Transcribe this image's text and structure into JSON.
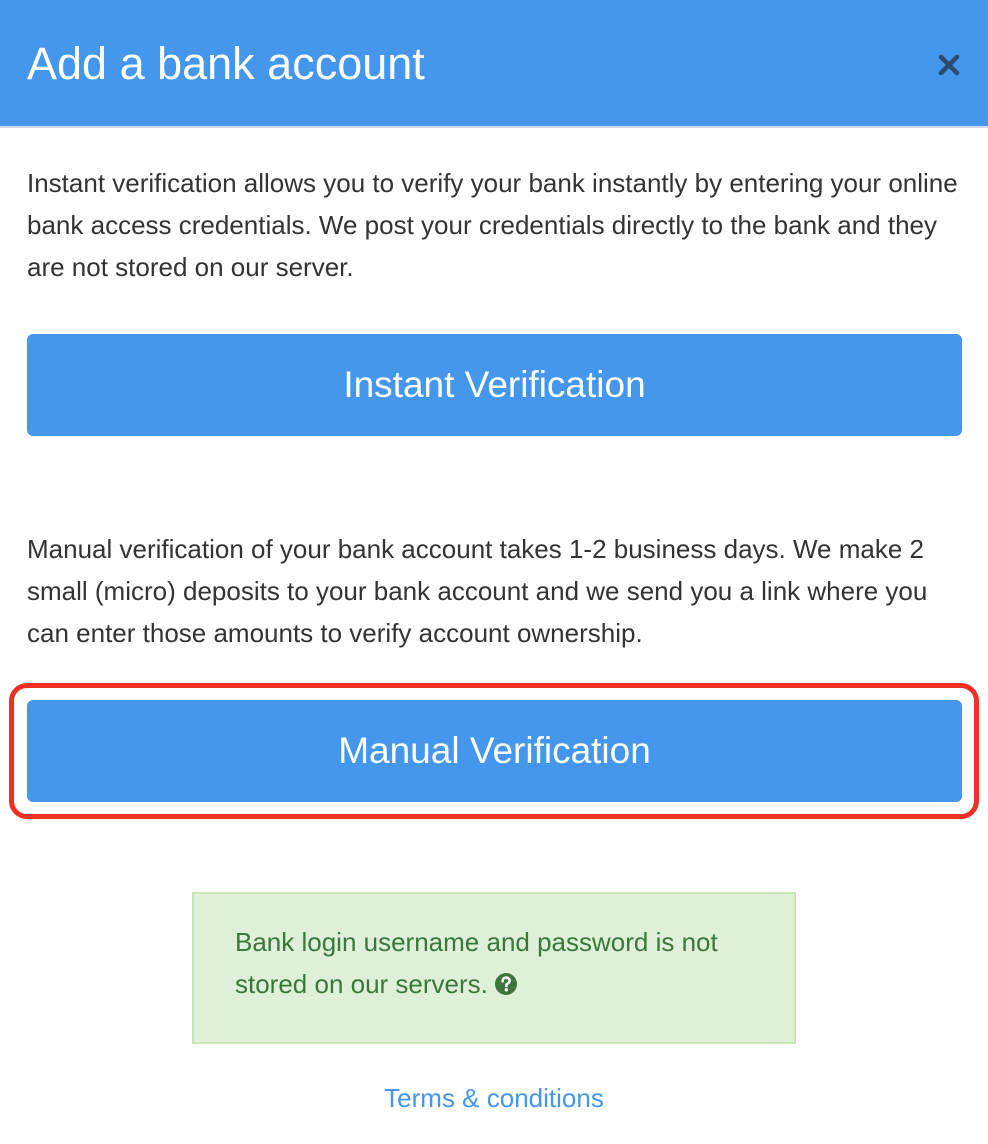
{
  "dialog": {
    "title": "Add a bank account",
    "close_label": "×",
    "close_icon": "close-icon"
  },
  "instant": {
    "description": "Instant verification allows you to verify your bank instantly by entering your online bank access credentials. We post your credentials directly to the bank and they are not stored on our server.",
    "button_label": "Instant Verification"
  },
  "manual": {
    "description": "Manual verification of your bank account takes 1-2 business days. We make 2 small (micro) deposits to your bank account and we send you a link where you can enter those amounts to verify account ownership.",
    "button_label": "Manual Verification",
    "highlighted": true
  },
  "notice": {
    "text": "Bank login username and password is not stored on our servers.",
    "icon": "question-circle-icon"
  },
  "footer": {
    "terms_link": "Terms & conditions"
  },
  "colors": {
    "primary": "#4497ec",
    "highlight_border": "#f03024",
    "notice_bg": "#dff0d8",
    "notice_text": "#3b763d"
  }
}
